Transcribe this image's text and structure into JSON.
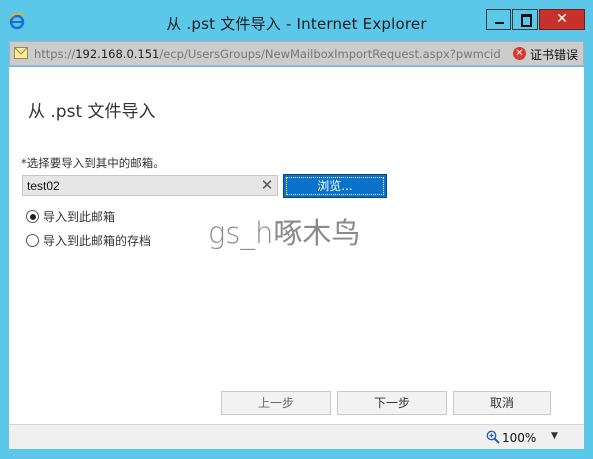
{
  "window": {
    "title": "从 .pst 文件导入 - Internet Explorer",
    "minimize_glyph": "",
    "close_glyph": "✕"
  },
  "address_bar": {
    "url_prefix": "https://",
    "url_host": "192.168.0.151",
    "url_path": "/ecp/UsersGroups/NewMailboxImportRequest.aspx?pwmcid",
    "cert_icon_glyph": "✕",
    "cert_error_label": "证书错误"
  },
  "page": {
    "title": "从 .pst 文件导入",
    "mailbox_label": "*选择要导入到其中的邮箱。",
    "mailbox_value": "test02",
    "clear_glyph": "✕",
    "browse_label": "浏览...",
    "radio_options": [
      {
        "label": "导入到此邮箱",
        "checked": true
      },
      {
        "label": "导入到此邮箱的存档",
        "checked": false
      }
    ],
    "watermark": "gs_h啄木鸟",
    "buttons": {
      "back": "上一步",
      "next": "下一步",
      "cancel": "取消"
    }
  },
  "status_bar": {
    "zoom": "100%",
    "zoom_caret": "▼"
  },
  "colors": {
    "frame": "#5bc8ea",
    "close_button": "#c7312b",
    "browse_button": "#0a72c9",
    "cert_error": "#d73a2e"
  },
  "icons": [
    "ie-logo-icon",
    "page-icon",
    "cert-error-icon",
    "clear-icon",
    "zoom-icon",
    "dropdown-caret-icon"
  ]
}
